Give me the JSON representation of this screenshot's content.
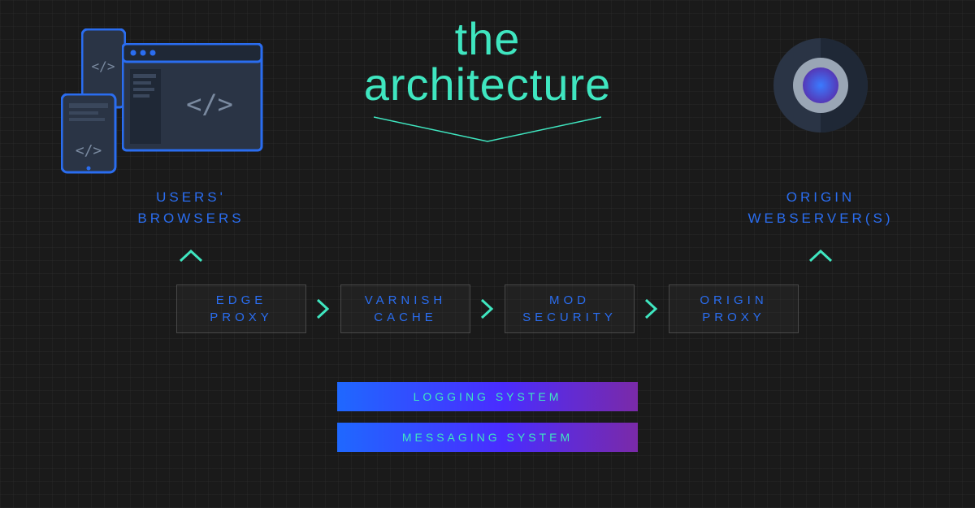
{
  "title": {
    "line1": "the",
    "line2": "architecture"
  },
  "endpoints": {
    "left": {
      "line1": "USERS'",
      "line2": "BROWSERS"
    },
    "right": {
      "line1": "ORIGIN",
      "line2": "WEBSERVER(S)"
    }
  },
  "flow": [
    {
      "line1": "EDGE",
      "line2": "PROXY"
    },
    {
      "line1": "VARNISH",
      "line2": "CACHE"
    },
    {
      "line1": "MOD",
      "line2": "SECURITY"
    },
    {
      "line1": "ORIGIN",
      "line2": "PROXY"
    }
  ],
  "bars": {
    "logging": "LOGGING SYSTEM",
    "messaging": "MESSAGING SYSTEM"
  },
  "colors": {
    "accent": "#3fe6c0",
    "blue": "#2a6df0",
    "grad_start": "#1f68ff",
    "grad_end": "#7a2aa8"
  }
}
